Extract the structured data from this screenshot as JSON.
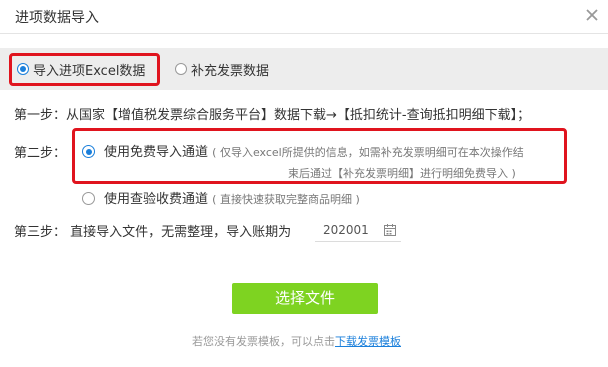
{
  "dialog": {
    "title": "进项数据导入",
    "close_icon": "close-icon"
  },
  "tabs": [
    {
      "label": "导入进项Excel数据",
      "selected": true
    },
    {
      "label": "补充发票数据",
      "selected": false
    }
  ],
  "steps": {
    "step1": "第一步：从国家【增值税发票综合服务平台】数据下载→【抵扣统计-查询抵扣明细下载】；",
    "step2_label": "第二步：",
    "step2_options": [
      {
        "label": "使用免费导入通道",
        "hint_line1": "( 仅导入excel所提供的信息，如需补充发票明细可在本次操作结",
        "hint_line2": "束后通过【补充发票明细】进行明细免费导入 )",
        "selected": true
      },
      {
        "label": "使用查验收费通道",
        "hint": "( 直接快速获取完整商品明细 )",
        "selected": false
      }
    ],
    "step3_label": "第三步：  直接导入文件，无需整理，导入账期为",
    "period_value": "202001",
    "period_icon": "calendar-icon"
  },
  "actions": {
    "select_file_label": "选择文件"
  },
  "footer": {
    "text": "若您没有发票模板，可以点击",
    "link_label": "下载发票模板"
  },
  "colors": {
    "accent": "#1a7fdb",
    "button": "#7ed321",
    "highlight": "#e0141e"
  }
}
